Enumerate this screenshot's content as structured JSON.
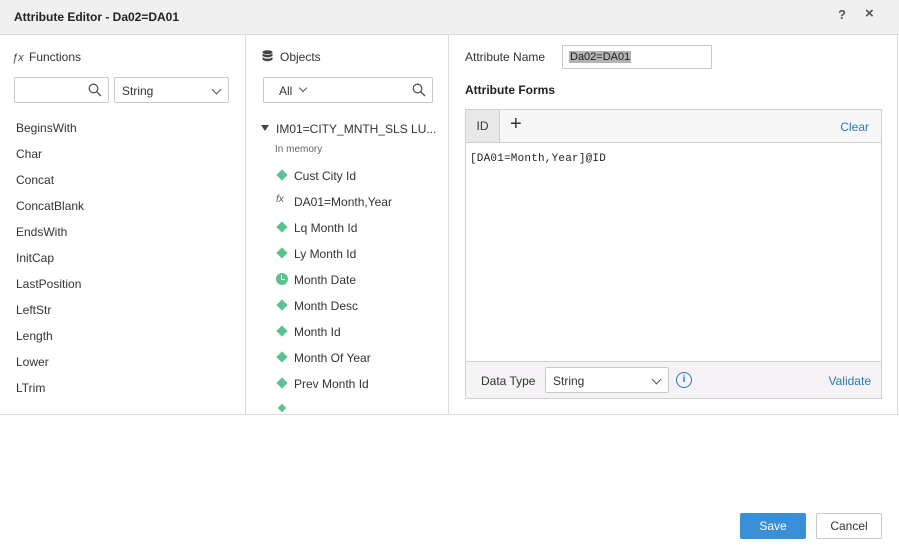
{
  "dialog": {
    "title": "Attribute Editor - Da02=DA01",
    "help_glyph": "?",
    "close_glyph": "×"
  },
  "functions": {
    "header": "Functions",
    "search_placeholder": "",
    "category": "String",
    "items": [
      "BeginsWith",
      "Char",
      "Concat",
      "ConcatBlank",
      "EndsWith",
      "InitCap",
      "LastPosition",
      "LeftStr",
      "Length",
      "Lower",
      "LTrim"
    ]
  },
  "objects": {
    "header": "Objects",
    "filter": "All",
    "tree_root": "IM01=CITY_MNTH_SLS LU...",
    "tree_sub": "In memory",
    "items": [
      {
        "label": "Cust City Id",
        "icon": "attribute-diamond-icon"
      },
      {
        "label": "DA01=Month,Year",
        "icon": "derived-fx-icon"
      },
      {
        "label": "Lq Month Id",
        "icon": "attribute-diamond-icon"
      },
      {
        "label": "Ly Month Id",
        "icon": "attribute-diamond-icon"
      },
      {
        "label": "Month Date",
        "icon": "date-clock-icon"
      },
      {
        "label": "Month Desc",
        "icon": "attribute-diamond-icon"
      },
      {
        "label": "Month Id",
        "icon": "attribute-diamond-icon"
      },
      {
        "label": "Month Of Year",
        "icon": "attribute-diamond-icon"
      },
      {
        "label": "Prev Month Id",
        "icon": "attribute-diamond-icon"
      }
    ]
  },
  "attribute": {
    "name_label": "Attribute Name",
    "name_value": "Da02=DA01",
    "forms_title": "Attribute Forms",
    "tab_id": "ID",
    "add_glyph": "+",
    "clear_label": "Clear",
    "expression": "[DA01=Month,Year]@ID",
    "data_type_label": "Data Type",
    "data_type_value": "String",
    "info_glyph": "i",
    "validate_label": "Validate"
  },
  "footer": {
    "save_label": "Save",
    "cancel_label": "Cancel"
  },
  "colors": {
    "accent": "#3a8fd9",
    "link": "#2a7ab8",
    "attribute_icon": "#5ec290"
  }
}
